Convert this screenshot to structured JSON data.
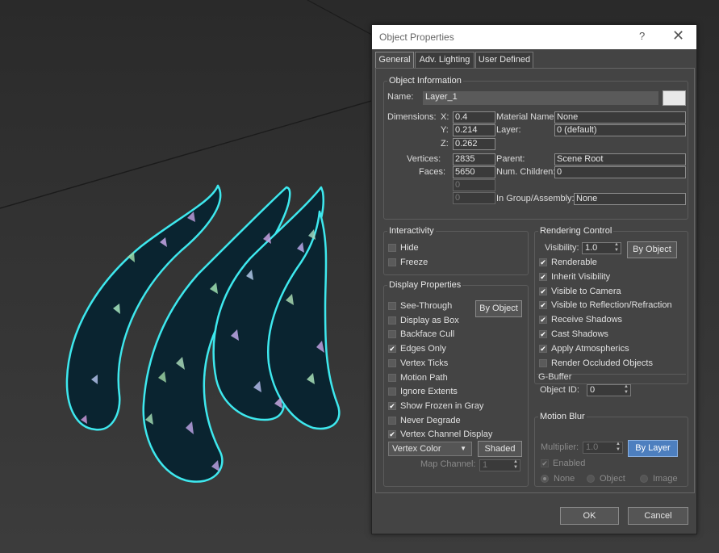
{
  "dialog": {
    "title": "Object Properties",
    "help": "?",
    "close": "✕",
    "tabs": [
      "General",
      "Adv. Lighting",
      "User Defined"
    ],
    "object_information": {
      "title": "Object Information",
      "name_label": "Name:",
      "name_value": "Layer_1",
      "dimensions_label": "Dimensions:",
      "x_label": "X:",
      "x_value": "0.4",
      "y_label": "Y:",
      "y_value": "0.214",
      "z_label": "Z:",
      "z_value": "0.262",
      "vertices_label": "Vertices:",
      "vertices_value": "2835",
      "faces_label": "Faces:",
      "faces_value": "5650",
      "extra1": "0",
      "extra2": "0",
      "material_label": "Material Name:",
      "material_value": "None",
      "layer_label": "Layer:",
      "layer_value": "0 (default)",
      "parent_label": "Parent:",
      "parent_value": "Scene Root",
      "children_label": "Num. Children:",
      "children_value": "0",
      "group_label": "In Group/Assembly:",
      "group_value": "None"
    },
    "interactivity": {
      "title": "Interactivity",
      "hide": "Hide",
      "freeze": "Freeze"
    },
    "display_properties": {
      "title": "Display Properties",
      "by_object": "By Object",
      "items": [
        {
          "label": "See-Through",
          "checked": false
        },
        {
          "label": "Display as Box",
          "checked": false
        },
        {
          "label": "Backface Cull",
          "checked": false
        },
        {
          "label": "Edges Only",
          "checked": true
        },
        {
          "label": "Vertex Ticks",
          "checked": false
        },
        {
          "label": "Motion Path",
          "checked": false
        },
        {
          "label": "Ignore Extents",
          "checked": false
        },
        {
          "label": "Show Frozen in Gray",
          "checked": true
        },
        {
          "label": "Never Degrade",
          "checked": false
        },
        {
          "label": "Vertex Channel Display",
          "checked": true
        }
      ],
      "vertex_color": "Vertex Color",
      "shaded": "Shaded",
      "map_channel_label": "Map Channel:",
      "map_channel_value": "1"
    },
    "rendering_control": {
      "title": "Rendering Control",
      "visibility_label": "Visibility:",
      "visibility_value": "1.0",
      "by_object": "By Object",
      "items": [
        {
          "label": "Renderable",
          "checked": true
        },
        {
          "label": "Inherit Visibility",
          "checked": true
        },
        {
          "label": "Visible to Camera",
          "checked": true
        },
        {
          "label": "Visible to Reflection/Refraction",
          "checked": true
        },
        {
          "label": "Receive Shadows",
          "checked": true
        },
        {
          "label": "Cast Shadows",
          "checked": true
        },
        {
          "label": "Apply Atmospherics",
          "checked": true
        },
        {
          "label": "Render Occluded Objects",
          "checked": false
        }
      ]
    },
    "gbuffer": {
      "title": "G-Buffer",
      "object_id_label": "Object ID:",
      "object_id_value": "0"
    },
    "motion_blur": {
      "title": "Motion Blur",
      "multiplier_label": "Multiplier:",
      "multiplier_value": "1.0",
      "by_layer": "By Layer",
      "enabled": "Enabled",
      "radio_none": "None",
      "radio_object": "Object",
      "radio_image": "Image"
    },
    "ok": "OK",
    "cancel": "Cancel"
  },
  "colors": {
    "highlight": "#f07d2b",
    "outline": "#3ee8ee",
    "accent_button": "#4d7fbf"
  }
}
